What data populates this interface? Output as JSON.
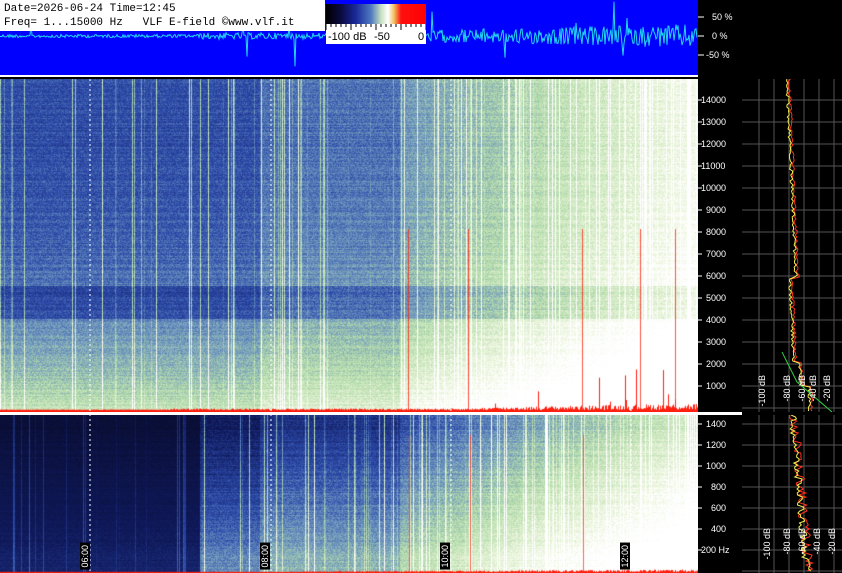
{
  "header": {
    "line1": "Date=2026-06-24 Time=12:45",
    "line2": "Freq= 1...15000 Hz   VLF E-field ©www.vlf.it"
  },
  "colorbar": {
    "labels": [
      "-100 dB",
      "-50",
      "0"
    ]
  },
  "waveform": {
    "labels": [
      "50 %",
      "0 %",
      "-50 %"
    ]
  },
  "upper_axis": {
    "ticks": [
      "14000",
      "13000",
      "12000",
      "11000",
      "10000",
      "9000",
      "8000",
      "7000",
      "6000",
      "5000",
      "4000",
      "3000",
      "2000",
      "1000"
    ]
  },
  "lower_axis": {
    "ticks": [
      "1400",
      "1200",
      "1000",
      "800",
      "600",
      "400",
      "200 Hz"
    ]
  },
  "time_labels": [
    "06:00",
    "08:00",
    "10:00",
    "12:00"
  ],
  "spectrum_upper": {
    "db_labels": [
      "-100 dB",
      "-80 dB",
      "-60 dB",
      "-40 dB",
      "-20 dB"
    ]
  },
  "spectrum_lower": {
    "db_labels": [
      "-100 dB",
      "-80 dB",
      "-60 dB",
      "-40 dB",
      "-20 dB"
    ]
  },
  "colors": {
    "background": "#000000",
    "wave_bg": "#0000ff",
    "wave_trace": "#22d7f0",
    "separator": "#ffffff"
  }
}
